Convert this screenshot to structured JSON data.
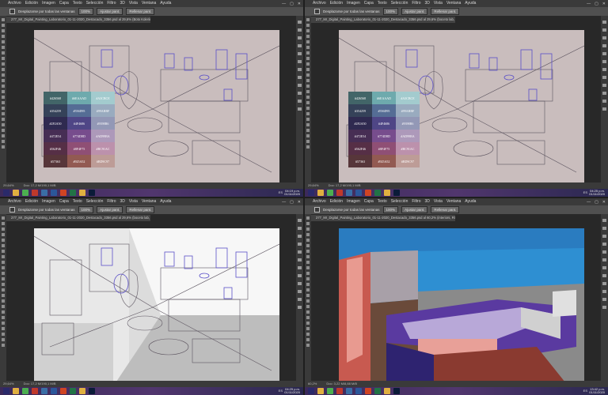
{
  "menu": [
    "Archivo",
    "Edición",
    "Imagen",
    "Capa",
    "Texto",
    "Selección",
    "Filtro",
    "3D",
    "Vista",
    "Ventana",
    "Ayuda"
  ],
  "window_controls": [
    "—",
    "▢",
    "✕"
  ],
  "options": {
    "scroll_all_windows": "Desplazarse por todas las ventanas",
    "zoom": "100%",
    "fit_screen": "Ajustar pant.",
    "fill_screen": "Rellenar pant."
  },
  "panels": [
    {
      "tab": "277_Mr_Digital_Painting_Laboratorio_01-11-2020_Destacado_3356.psd al 29,6% (Boto Kolerin, RGB/8) *",
      "status_zoom": "29,64%",
      "status_doc": "Doc: 17,2 M/190,1 M/B",
      "taskbar_sys": "ES",
      "clock_time": "04:19 p.m.",
      "clock_date": "01/11/2020",
      "palette": [
        "#426568",
        "#6EAAAD",
        "#A3CBCE",
        "#354259",
        "#556D95",
        "#99ABBF",
        "#2F2A50",
        "#4F4686",
        "#9398B6",
        "#472E54",
        "#774D8D",
        "#AD99BA",
        "#562F46",
        "#8F4F75",
        "#BC91AC",
        "#57363",
        "#925A52",
        "#BD9C97"
      ]
    },
    {
      "tab": "277_Mr_Digital_Painting_Laboratorio_01-11-2020_Destacado_3356.psd al 29,6% (boceto lab, RGB/8) *",
      "status_zoom": "29,64%",
      "status_doc": "Doc: 17,2 M/190,1 M/B",
      "taskbar_sys": "ES",
      "clock_time": "04:25 p.m.",
      "clock_date": "01/11/2020",
      "palette": [
        "#426568",
        "#6EAAAD",
        "#A3CBCE",
        "#354259",
        "#556D95",
        "#99ABBF",
        "#2F2A50",
        "#4F4686",
        "#9398B6",
        "#472E54",
        "#774D8D",
        "#AD99BA",
        "#562F46",
        "#8F4F75",
        "#BC91AC",
        "#57363",
        "#925A52",
        "#BD9C97"
      ]
    },
    {
      "tab": "277_Mr_Digital_Painting_Laboratorio_01-11-2020_Destacado_3356.psd al 29,6% (boceto lab, RGB/8) *",
      "status_zoom": "29,64%",
      "status_doc": "Doc: 17,2 M/190,1 M/B",
      "taskbar_sys": "ES",
      "clock_time": "04:25 p.m.",
      "clock_date": "01/11/2020",
      "palette": []
    },
    {
      "tab": "277_Mr_Digital_Painting_Laboratorio_01-11-2020_Destacado_3356.psd al 60,2% (interiors, RGB/8) *",
      "status_zoom": "60,2%",
      "status_doc": "Doc: 3,22 M/8,88 M/B",
      "taskbar_sys": "ES",
      "clock_time": "13:42 p.m.",
      "clock_date": "01/11/2020",
      "palette": []
    }
  ],
  "colors": {
    "ps_dark": "#282828",
    "ps_panel": "#3a3a3a",
    "canvas_sketch": "#c9bdbd",
    "line_blue": "#5a4fc8",
    "wall_blue": "#2e8fd2",
    "floor_violet": "#5a3aa0",
    "pink": "#e8a098",
    "lilac": "#b8a8d8",
    "brown": "#8a3a30",
    "gray": "#8a8a8a"
  }
}
